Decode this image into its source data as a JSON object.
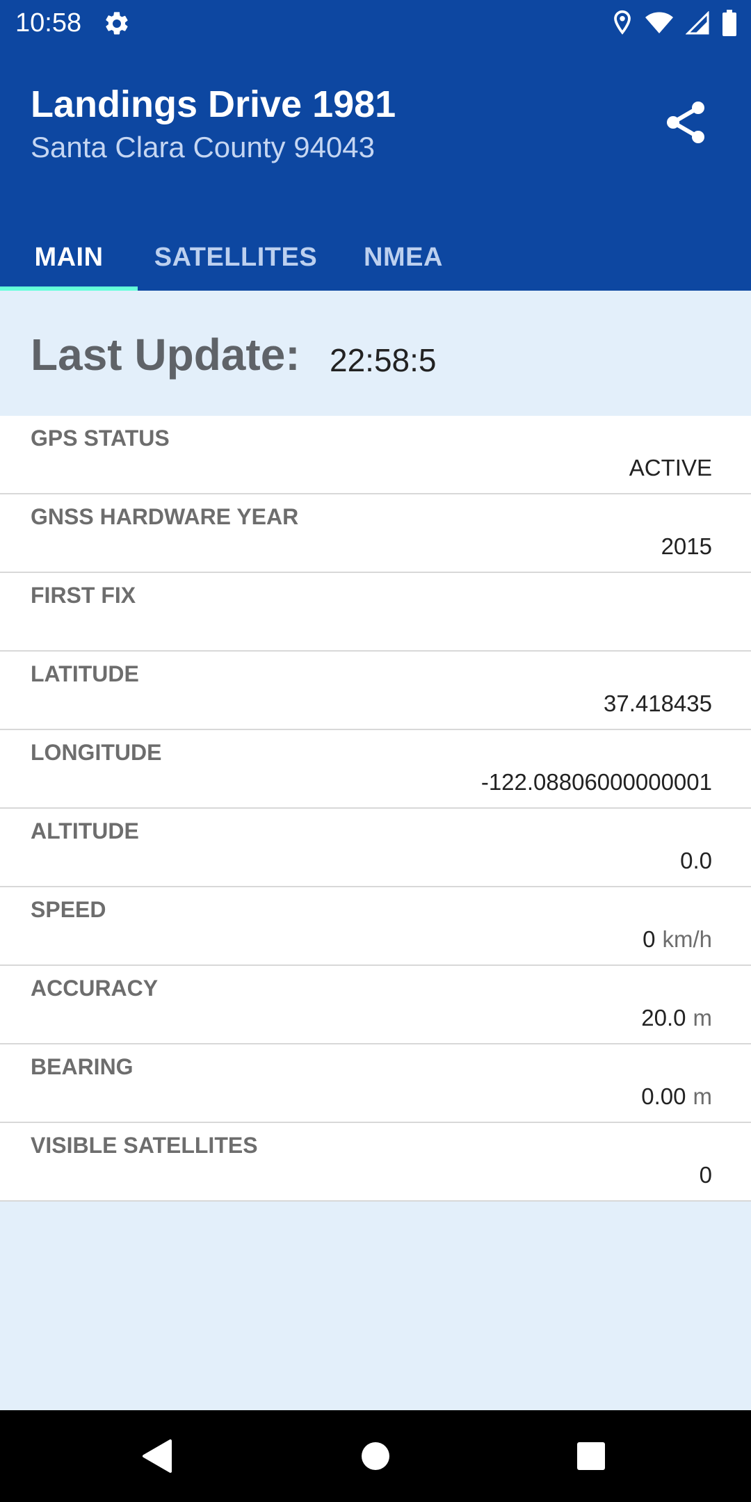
{
  "status_bar": {
    "time": "10:58",
    "icons": [
      "settings-gear-icon",
      "location-icon",
      "wifi-icon",
      "signal-icon",
      "battery-icon"
    ]
  },
  "app_bar": {
    "title": "Landings Drive 1981",
    "subtitle": "Santa Clara County 94043",
    "share_icon": "share-icon"
  },
  "tabs": [
    {
      "label": "MAIN",
      "active": true
    },
    {
      "label": "SATELLITES",
      "active": false
    },
    {
      "label": "NMEA",
      "active": false
    }
  ],
  "last_update": {
    "label": "Last Update:",
    "value": "22:58:5"
  },
  "rows": [
    {
      "label": "GPS STATUS",
      "value": "ACTIVE",
      "unit": ""
    },
    {
      "label": "GNSS HARDWARE YEAR",
      "value": "2015",
      "unit": ""
    },
    {
      "label": "FIRST FIX",
      "value": "",
      "unit": ""
    },
    {
      "label": "LATITUDE",
      "value": "37.418435",
      "unit": ""
    },
    {
      "label": "LONGITUDE",
      "value": "-122.08806000000001",
      "unit": ""
    },
    {
      "label": "ALTITUDE",
      "value": "0.0",
      "unit": ""
    },
    {
      "label": "SPEED",
      "value": "0",
      "unit": "km/h"
    },
    {
      "label": "ACCURACY",
      "value": "20.0",
      "unit": "m"
    },
    {
      "label": "BEARING",
      "value": "0.00",
      "unit": "m"
    },
    {
      "label": "VISIBLE SATELLITES",
      "value": "0",
      "unit": ""
    }
  ],
  "nav_bar": {
    "buttons": [
      "back-icon",
      "home-icon",
      "recents-icon"
    ]
  },
  "colors": {
    "primary": "#0d47a1",
    "tab_indicator": "#64ffda",
    "content_background": "#e3effa",
    "row_label": "#6d6d6d"
  }
}
